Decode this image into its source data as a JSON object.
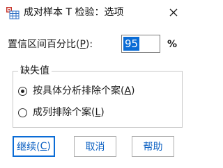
{
  "window": {
    "title": "成对样本 T 检验：选项",
    "close_symbol": "✕"
  },
  "confidence": {
    "label_prefix": "置信区间百分比(",
    "label_mnemonic": "P",
    "label_suffix": "):",
    "value": "95",
    "unit": "%"
  },
  "missing": {
    "legend": "缺失值",
    "option1": {
      "prefix": "按具体分析排除个案(",
      "mnemonic": "A",
      "suffix": ")",
      "selected": true
    },
    "option2": {
      "prefix": "成列排除个案(",
      "mnemonic": "L",
      "suffix": ")",
      "selected": false
    }
  },
  "buttons": {
    "continue": {
      "prefix": "继续(",
      "mnemonic": "C",
      "suffix": ")"
    },
    "cancel": "取消",
    "help": "帮助"
  },
  "colors": {
    "accent": "#0a6cd6",
    "button_text": "#0a5fc2",
    "icon_red": "#c8372d",
    "icon_blue": "#2f6fc4"
  },
  "icons": {
    "app": "spss-table-icon",
    "close": "close-icon"
  }
}
